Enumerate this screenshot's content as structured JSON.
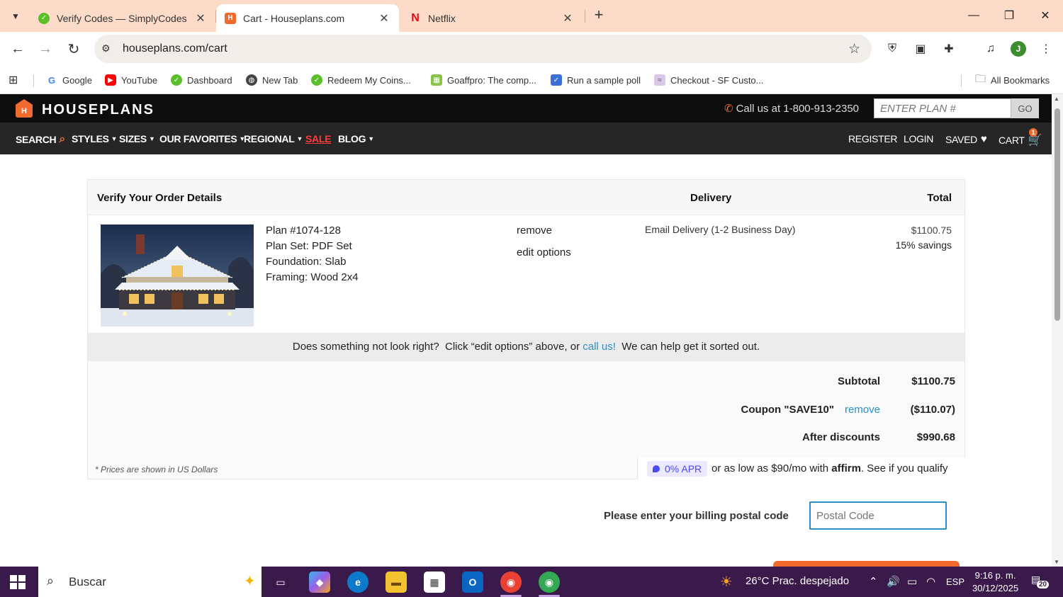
{
  "browser": {
    "tabs": [
      {
        "title": "Verify Codes — SimplyCodes",
        "icon": "simplycodes-icon",
        "active": false
      },
      {
        "title": "Cart - Houseplans.com",
        "icon": "houseplans-icon",
        "active": true
      },
      {
        "title": "Netflix",
        "icon": "netflix-icon",
        "active": false
      }
    ],
    "url": "houseplans.com/cart",
    "profile_initial": "J",
    "bookmarks": [
      {
        "label": "Google",
        "icon": "google-icon"
      },
      {
        "label": "YouTube",
        "icon": "youtube-icon"
      },
      {
        "label": "Dashboard",
        "icon": "simplycodes-icon"
      },
      {
        "label": "New Tab",
        "icon": "globe-icon"
      },
      {
        "label": "Redeem My Coins...",
        "icon": "simplycodes-icon"
      },
      {
        "label": "Goaffpro: The comp...",
        "icon": "goaffpro-icon"
      },
      {
        "label": "Run a sample poll",
        "icon": "poll-icon"
      },
      {
        "label": "Checkout - SF Custo...",
        "icon": "salesforce-icon"
      }
    ],
    "all_bookmarks": "All Bookmarks"
  },
  "site": {
    "logo": "HOUSEPLANS",
    "call_us": "Call us at 1-800-913-2350",
    "plan_placeholder": "ENTER PLAN #",
    "go_label": "GO",
    "nav": {
      "search": "SEARCH",
      "styles": "STYLES",
      "sizes": "SIZES",
      "favorites": "OUR FAVORITES",
      "regional": "REGIONAL",
      "sale": "SALE",
      "blog": "BLOG",
      "register": "REGISTER",
      "login": "LOGIN",
      "saved": "SAVED",
      "cart": "CART",
      "cart_count": "1"
    }
  },
  "order": {
    "heading": "Verify Your Order Details",
    "delivery_heading": "Delivery",
    "total_heading": "Total",
    "item": {
      "plan": "Plan #1074-128",
      "plan_set": "Plan Set: PDF Set",
      "foundation": "Foundation: Slab",
      "framing": "Framing: Wood 2x4",
      "remove": "remove",
      "edit": "edit options",
      "delivery": "Email Delivery (1-2 Business Day)",
      "price": "$1100.75",
      "savings": "15% savings"
    },
    "help": {
      "pre": "Does something not look right?  Click “edit options” above, or ",
      "link": "call us!",
      "post": "  We can help get it sorted out."
    },
    "subtotal_label": "Subtotal",
    "subtotal_value": "$1100.75",
    "coupon_label": "Coupon \"SAVE10\"",
    "coupon_remove": "remove",
    "coupon_value": "($110.07)",
    "after_label": "After discounts",
    "after_value": "$990.68",
    "footnote": "* Prices are shown in US Dollars",
    "affirm_badge": "0% APR",
    "affirm_pre": "or as low as $90/mo with ",
    "affirm_brand": "affirm",
    "affirm_post": ". See if you qualify",
    "postal_label": "Please enter your billing postal code",
    "postal_placeholder": "Postal Code"
  },
  "taskbar": {
    "search_text": "Buscar",
    "weather": "26°C  Prac. despejado",
    "lang": "ESP",
    "time": "9:16 p. m.",
    "date": "30/12/2025",
    "notifications": "20"
  },
  "colors": {
    "accent_orange": "#f26b2e",
    "link_blue": "#2a8fc4",
    "savings_green": "#7fb23a",
    "sale_red": "#ff3b3b",
    "affirm_purple": "#4a4af4"
  }
}
